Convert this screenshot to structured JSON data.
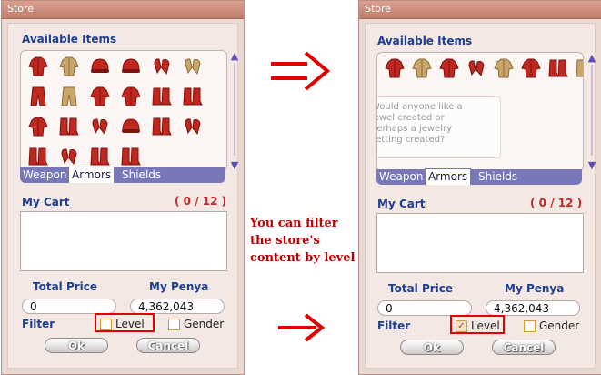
{
  "left_window": {
    "title": "Store",
    "available_items_label": "Available Items",
    "tabs": [
      "Weapon",
      "Armors",
      "Shields"
    ],
    "active_tab": "Armors",
    "cart_label": "My Cart",
    "cart_count": "( 0 / 12 )",
    "total_price_label": "Total Price",
    "my_penya_label": "My Penya",
    "total_price_value": "0",
    "my_penya_value": "4,362,043",
    "filter_label": "Filter",
    "level_label": "Level",
    "level_checked": false,
    "gender_label": "Gender",
    "ok_label": "Ok",
    "cancel_label": "Cancel",
    "items": [
      "red-jacket-icon",
      "tan-jacket-icon",
      "red-helmet-icon",
      "red-cap-icon",
      "red-gloves-icon",
      "tan-gloves-icon",
      "red-pants-icon",
      "tan-pants-icon",
      "red-suit-icon",
      "red-suit-icon",
      "red-boots-icon",
      "red-boots-icon",
      "red-jacket-icon",
      "red-boots-icon",
      "red-gloves-icon",
      "red-cap-icon",
      "red-boots-icon",
      "red-gloves-icon",
      "red-boots-icon",
      "red-gloves-icon",
      "red-boots-icon",
      "red-boots-icon"
    ]
  },
  "right_window": {
    "title": "Store",
    "available_items_label": "Available Items",
    "tabs": [
      "Weapon",
      "Armors",
      "Shields"
    ],
    "active_tab": "Armors",
    "overlay_text": [
      "Would anyone like a",
      "jewel created or",
      "perhaps a jewelry",
      "setting created?"
    ],
    "cart_label": "My Cart",
    "cart_count": "( 0 / 12 )",
    "total_price_label": "Total Price",
    "my_penya_label": "My Penya",
    "total_price_value": "0",
    "my_penya_value": "4,362,043",
    "filter_label": "Filter",
    "level_label": "Level",
    "level_checked": true,
    "gender_label": "Gender",
    "ok_label": "Ok",
    "cancel_label": "Cancel",
    "items": [
      "red-jacket-icon",
      "tan-jacket-icon",
      "red-jacket-icon",
      "red-gloves-icon",
      "tan-jacket-icon",
      "red-suit-icon",
      "red-boots-icon",
      "tan-boots-icon"
    ]
  },
  "caption_lines": [
    "You can filter",
    "the store's",
    "content by level"
  ],
  "colors": {
    "window_bg": "#e9d9d3",
    "title_bar": "#c27d6c",
    "label_blue": "#1e3e8e",
    "count_red": "#c62828",
    "tab_bar": "#7877b8",
    "arrow_red": "#e00000",
    "item_red": "#c0271f",
    "item_tan": "#c9a56a"
  }
}
